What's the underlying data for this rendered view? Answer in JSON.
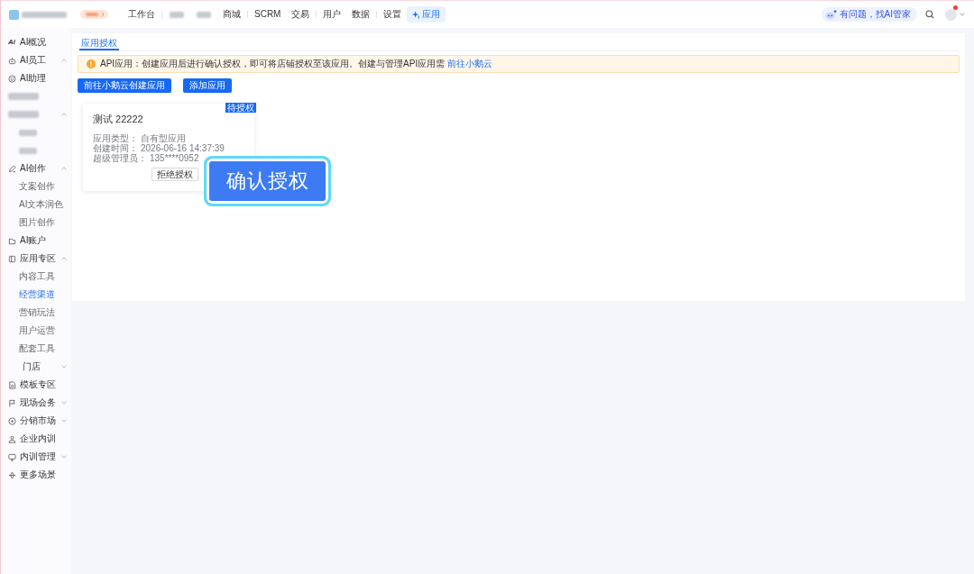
{
  "header": {
    "nav_groups": [
      {
        "items": [
          {
            "kind": "text",
            "label": "工作台",
            "selected": false
          }
        ]
      },
      {
        "items": [
          {
            "kind": "blurred",
            "selected": false
          },
          {
            "kind": "blurred",
            "selected": false
          },
          {
            "kind": "text",
            "label": "商城",
            "selected": false
          }
        ]
      },
      {
        "items": [
          {
            "kind": "text",
            "label": "SCRM",
            "selected": false
          },
          {
            "kind": "text",
            "label": "交易",
            "selected": false
          }
        ]
      },
      {
        "items": [
          {
            "kind": "text",
            "label": "用户",
            "selected": false
          },
          {
            "kind": "text",
            "label": "数据",
            "selected": false
          }
        ]
      },
      {
        "items": [
          {
            "kind": "text",
            "label": "设置",
            "selected": false
          },
          {
            "kind": "ai",
            "label": "应用",
            "selected": true
          }
        ]
      }
    ],
    "assistant": {
      "label": "有问题，找AI管家"
    },
    "avatar": {
      "unread": true
    }
  },
  "sidebar": {
    "items": [
      {
        "kind": "entry",
        "label": "AI概况",
        "icon_text": "Ai",
        "selected": false
      },
      {
        "kind": "entry",
        "label": "AI员工",
        "expanded": true,
        "selected": false
      },
      {
        "kind": "entry",
        "label": "AI助理",
        "selected": false
      },
      {
        "kind": "blurred",
        "selected": false
      },
      {
        "kind": "blurred",
        "expanded": true,
        "selected": false,
        "children": [
          {
            "kind": "blurred",
            "selected": false
          },
          {
            "kind": "blurred",
            "selected": false
          }
        ]
      },
      {
        "kind": "entry",
        "label": "AI创作",
        "expanded": true,
        "selected": false,
        "children": [
          {
            "kind": "entry",
            "label": "文案创作",
            "selected": false
          },
          {
            "kind": "entry",
            "label": "AI文本润色",
            "selected": false
          },
          {
            "kind": "entry",
            "label": "图片创作",
            "selected": false
          }
        ]
      },
      {
        "kind": "entry",
        "label": "AI账户",
        "selected": false
      },
      {
        "kind": "entry",
        "label": "应用专区",
        "expanded": true,
        "selected": false,
        "children": [
          {
            "kind": "entry",
            "label": "内容工具",
            "selected": false
          },
          {
            "kind": "entry",
            "label": "经营渠道",
            "selected": true
          },
          {
            "kind": "entry",
            "label": "营销玩法",
            "selected": false
          },
          {
            "kind": "entry",
            "label": "用户运营",
            "selected": false
          },
          {
            "kind": "entry",
            "label": "配套工具",
            "selected": false
          }
        ]
      },
      {
        "kind": "entry",
        "label": "门店",
        "expanded": false,
        "selected": false
      },
      {
        "kind": "entry",
        "label": "模板专区",
        "selected": false
      },
      {
        "kind": "entry",
        "label": "现场会务",
        "expanded": false,
        "selected": false
      },
      {
        "kind": "entry",
        "label": "分销市场",
        "expanded": false,
        "selected": false
      },
      {
        "kind": "entry",
        "label": "企业内训",
        "selected": false
      },
      {
        "kind": "entry",
        "label": "内训管理",
        "expanded": false,
        "selected": false
      },
      {
        "kind": "entry",
        "label": "更多场景",
        "selected": false
      }
    ]
  },
  "tabs": [
    {
      "label": "应用授权",
      "selected": true
    }
  ],
  "alert": {
    "text": "API应用：创建应用后进行确认授权，即可将店铺授权至该应用。创建与管理API应用需",
    "link": "前往小鹅云"
  },
  "buttons": [
    {
      "label": "前往小鹅云创建应用"
    },
    {
      "label": "添加应用"
    }
  ],
  "apps": [
    {
      "status": "待授权",
      "title": "测试 22222",
      "fields": [
        {
          "label": "应用类型：",
          "value": "自有型应用"
        },
        {
          "label": "创建时间：",
          "value": "2026-06-16 14:37:39"
        },
        {
          "label": "超级管理员：",
          "value": "135****0952"
        }
      ],
      "actions": [
        {
          "kind": "outline",
          "label": "拒绝授权"
        },
        {
          "kind": "callout",
          "label": "确认授权"
        }
      ]
    }
  ]
}
